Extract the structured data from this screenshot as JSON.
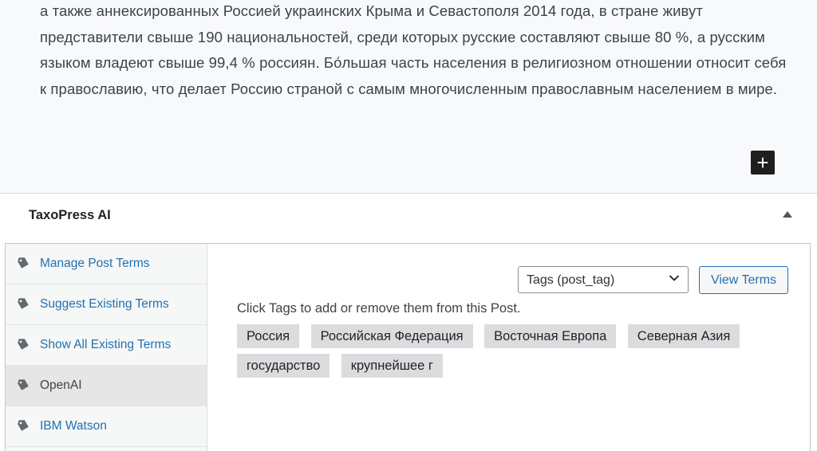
{
  "editor": {
    "paragraph": "а также аннексированных Россией украинских Крыма и Севастополя 2014 года, в стране живут представители свыше 190 национальностей, среди которых русские составляют свыше 80 %, а русским языком владеют свыше 99,4 % россиян. Бо́льшая часть населения в религиозном отношении относит себя к православию, что делает Россию страной с самым многочисленным православным населением в мире.",
    "add_block_symbol": "+"
  },
  "panel": {
    "title": "TaxoPress AI",
    "toggle_icon": "triangle-up-icon"
  },
  "sidebar": {
    "items": [
      {
        "label": "Manage Post Terms",
        "icon": "tag-icon",
        "active": false
      },
      {
        "label": "Suggest Existing Terms",
        "icon": "tag-icon",
        "active": false
      },
      {
        "label": "Show All Existing Terms",
        "icon": "tag-icon",
        "active": false
      },
      {
        "label": "OpenAI",
        "icon": "tag-icon",
        "active": true
      },
      {
        "label": "IBM Watson",
        "icon": "tag-icon",
        "active": false
      }
    ]
  },
  "content": {
    "taxonomy_select": {
      "selected": "Tags (post_tag)"
    },
    "view_terms_label": "View Terms",
    "hint": "Click Tags to add or remove them from this Post.",
    "tags": [
      "Россия",
      "Российская Федерация",
      "Восточная Европа",
      "Северная Азия",
      "государство",
      "крупнейшее г"
    ]
  },
  "colors": {
    "link": "#2271b1",
    "tag_background": "#dcdcde",
    "editor_background": "#f8f9fb"
  }
}
